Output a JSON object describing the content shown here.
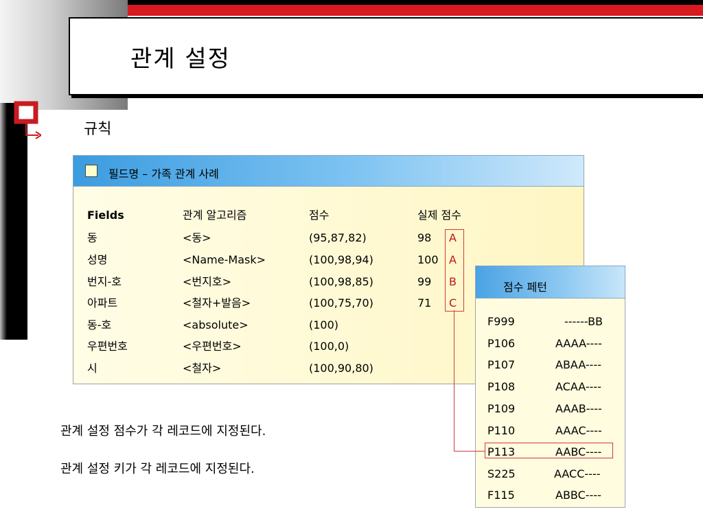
{
  "title": "관계 설정",
  "section_heading": "규칙",
  "panel": {
    "header": "필드명 – 가족 관계 사례",
    "columns": [
      "Fields",
      "관계 알고리즘",
      "점수",
      "실제 점수"
    ],
    "rows": [
      {
        "field": "동",
        "algorithm": "<동>",
        "score": "(95,87,82)",
        "actual": "98",
        "grade": "A"
      },
      {
        "field": "성명",
        "algorithm": "<Name-Mask>",
        "score": "(100,98,94)",
        "actual": "100",
        "grade": "A"
      },
      {
        "field": "번지-호",
        "algorithm": "<번지호>",
        "score": "(100,98,85)",
        "actual": "99",
        "grade": "B"
      },
      {
        "field": "아파트",
        "algorithm": "<철자+발음>",
        "score": "(100,75,70)",
        "actual": "71",
        "grade": "C"
      },
      {
        "field": "동-호",
        "algorithm": "<absolute>",
        "score": "(100)",
        "actual": "",
        "grade": ""
      },
      {
        "field": "우편번호",
        "algorithm": "<우편번호>",
        "score": "(100,0)",
        "actual": "",
        "grade": ""
      },
      {
        "field": "시",
        "algorithm": "<철자>",
        "score": "(100,90,80)",
        "actual": "",
        "grade": ""
      }
    ]
  },
  "pattern": {
    "title": "점수 페턴",
    "rows": [
      {
        "code": "F999",
        "pattern": "------BB"
      },
      {
        "code": "P106",
        "pattern": "AAAA----"
      },
      {
        "code": "P107",
        "pattern": "ABAA----"
      },
      {
        "code": "P108",
        "pattern": "ACAA----"
      },
      {
        "code": "P109",
        "pattern": "AAAB----"
      },
      {
        "code": "P110",
        "pattern": "AAAC----"
      },
      {
        "code": "P113",
        "pattern": "AABC----"
      },
      {
        "code": "S225",
        "pattern": "AACC----"
      },
      {
        "code": "F115",
        "pattern": "ABBC----"
      }
    ]
  },
  "notes": [
    "관계 설정 점수가 각 레코드에 지정된다.",
    "관계 설정 키가 각 레코드에 지정된다."
  ],
  "colors": {
    "accent_red": "#d71920",
    "header_blue": "#3b9ce0",
    "panel_yellow": "#fff6c4"
  }
}
